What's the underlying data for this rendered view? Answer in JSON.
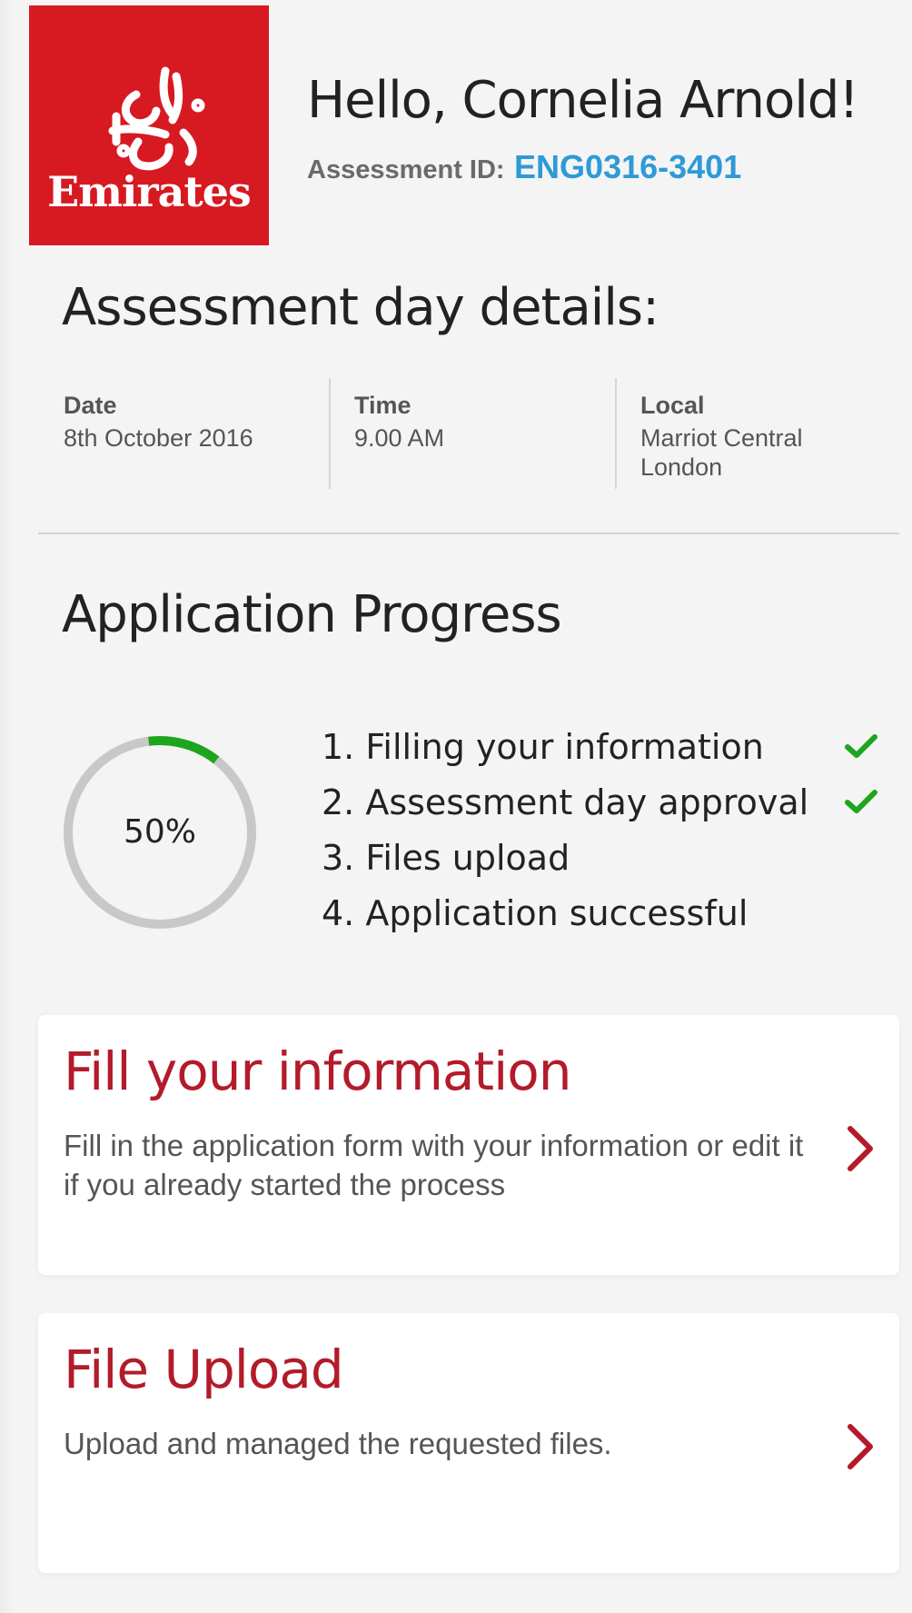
{
  "header": {
    "logo_text": "Emirates",
    "greeting": "Hello, Cornelia Arnold!",
    "assessment_id_label": "Assessment ID:",
    "assessment_id_value": "ENG0316-3401"
  },
  "details": {
    "title": "Assessment day details:",
    "date": {
      "label": "Date",
      "value": "8th October 2016"
    },
    "time": {
      "label": "Time",
      "value": "9.00 AM"
    },
    "local": {
      "label": "Local",
      "value": "Marriot Central\nLondon"
    }
  },
  "progress": {
    "title": "Application Progress",
    "percent_label": "50%",
    "ring_fill_fraction": 0.125,
    "steps": [
      {
        "label": "1. Filling your information",
        "done": true
      },
      {
        "label": "2. Assessment day approval",
        "done": true
      },
      {
        "label": "3. Files upload",
        "done": false
      },
      {
        "label": "4. Application successful",
        "done": false
      }
    ]
  },
  "cards": [
    {
      "title": "Fill your information",
      "description": "Fill in the application form with your information or edit it if you already started the process"
    },
    {
      "title": "File Upload",
      "description": "Upload and managed the requested files."
    }
  ],
  "colors": {
    "brand_red": "#d71921",
    "card_title_red": "#b31b2a",
    "accent_blue": "#2e9ad6",
    "progress_green": "#1ea51e",
    "ring_grey": "#c8c8c8"
  },
  "icons": {
    "logo": "emirates-calligraphy-logo",
    "check": "check-icon",
    "arrow": "chevron-right-icon"
  }
}
